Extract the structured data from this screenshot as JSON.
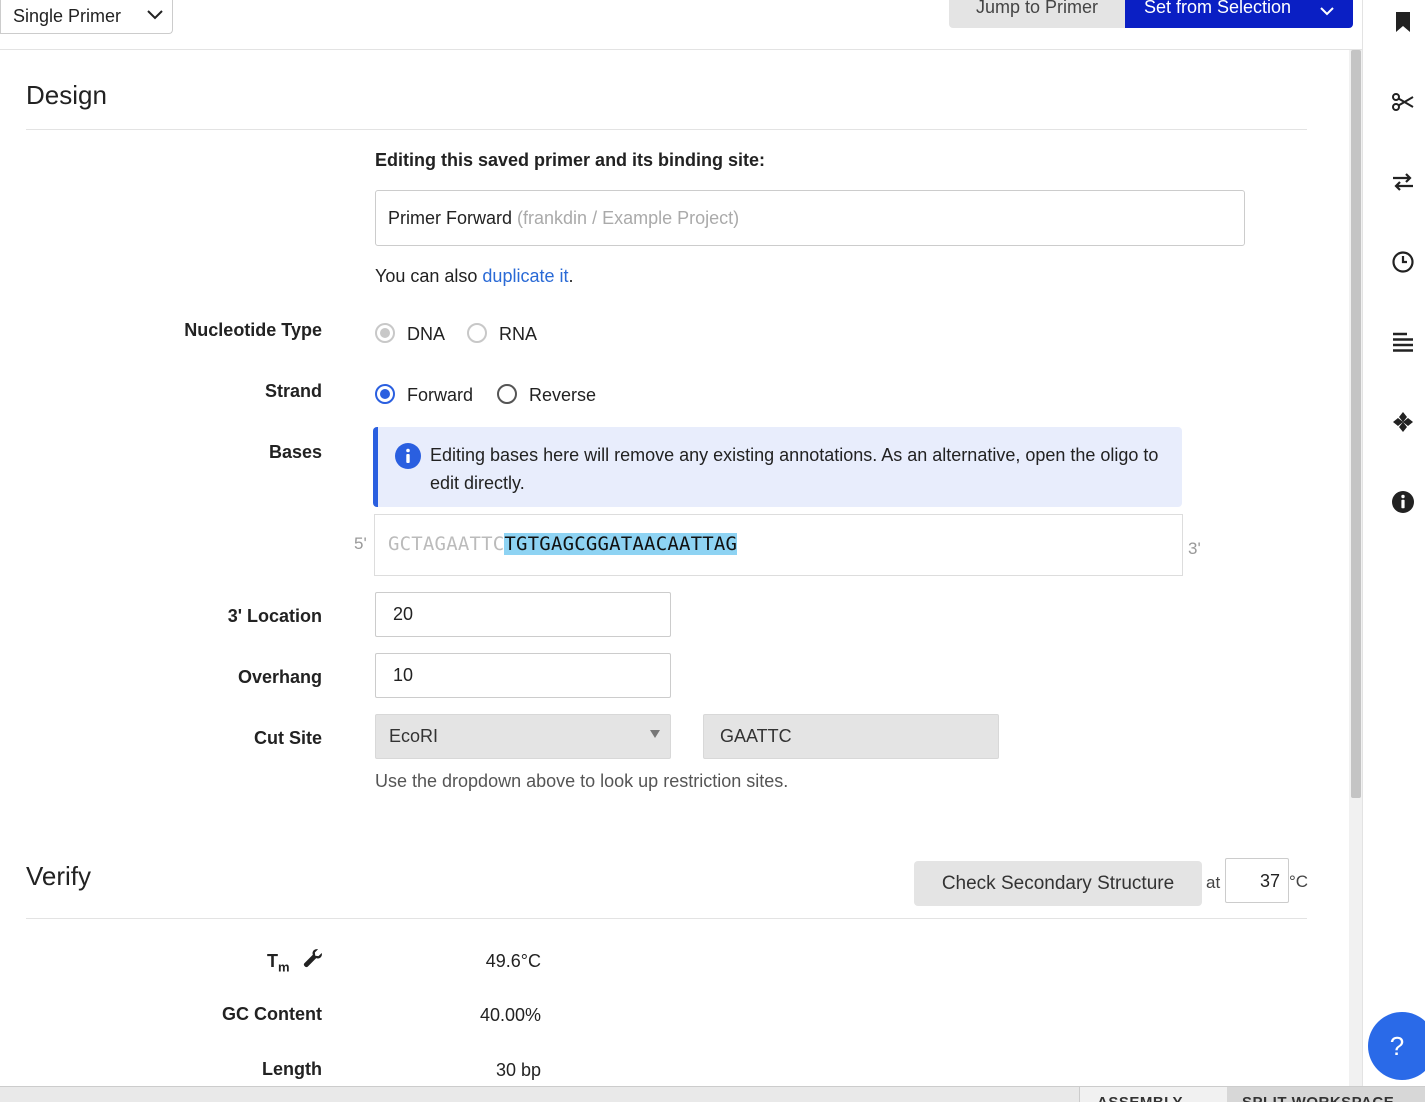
{
  "toolbar": {
    "mode_select": "Single Primer",
    "jump_label": "Jump to Primer",
    "set_label": "Set from Selection"
  },
  "design": {
    "title": "Design",
    "editing_heading": "Editing this saved primer and its binding site:",
    "primer_name": "Primer Forward",
    "primer_path": "(frankdin / Example Project)",
    "duplicate_prefix": "You can also ",
    "duplicate_link": "duplicate it",
    "duplicate_suffix": ".",
    "nucleotide_label": "Nucleotide Type",
    "dna_label": "DNA",
    "rna_label": "RNA",
    "strand_label": "Strand",
    "forward_label": "Forward",
    "reverse_label": "Reverse",
    "bases_label": "Bases",
    "info_message": "Editing bases here will remove any existing annotations. As an alternative, open the oligo to edit directly.",
    "five_prime": "5'",
    "three_prime": "3'",
    "overhang_bases": "GCTAGAATTC",
    "binding_bases": "TGTGAGCGGATAACAATTAG",
    "location_label": "3' Location",
    "location_value": "20",
    "overhang_label": "Overhang",
    "overhang_value": "10",
    "cutsite_label": "Cut Site",
    "cutsite_enzyme": "EcoRI",
    "cutsite_seq": "GAATTC",
    "cutsite_hint": "Use the dropdown above to look up restriction sites."
  },
  "verify": {
    "title": "Verify",
    "check_button": "Check Secondary Structure",
    "at_label": "at",
    "temp_value": "37",
    "temp_unit": "°C",
    "tm_label": "T",
    "tm_sub": "m",
    "tm_value": "49.6°C",
    "gc_label": "GC Content",
    "gc_value": "40.00%",
    "length_label": "Length",
    "length_value": "30 bp"
  },
  "help": {
    "label": "?"
  },
  "bottom_tabs": {
    "assembly": "ASSEMBLY",
    "split": "SPLIT WORKSPACE"
  },
  "colors": {
    "accent": "#0a1fc4",
    "link": "#2a6ad6",
    "highlight": "#8ed3f3",
    "info_bg": "#e8edfc"
  }
}
